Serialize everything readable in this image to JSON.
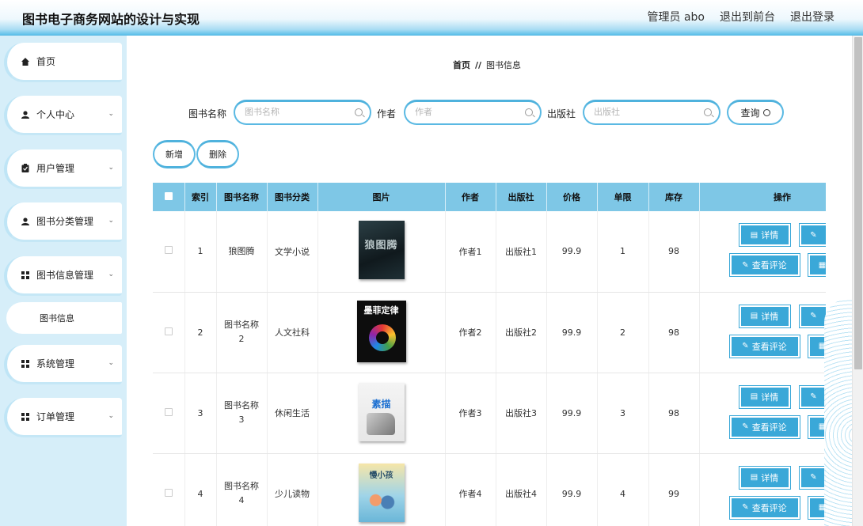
{
  "header": {
    "title": "图书电子商务网站的设计与实现",
    "user": "管理员 abo",
    "to_front": "退出到前台",
    "logout": "退出登录"
  },
  "sidebar": {
    "items": [
      {
        "label": "首页",
        "icon": "home-icon"
      },
      {
        "label": "个人中心",
        "icon": "person-icon"
      },
      {
        "label": "用户管理",
        "icon": "clipboard-icon"
      },
      {
        "label": "图书分类管理",
        "icon": "person-icon"
      },
      {
        "label": "图书信息管理",
        "icon": "grid-icon"
      },
      {
        "label": "系统管理",
        "icon": "grid-icon"
      },
      {
        "label": "订单管理",
        "icon": "grid-icon"
      }
    ],
    "subitem": "图书信息"
  },
  "breadcrumb": {
    "home": "首页",
    "sep": "//",
    "current": "图书信息"
  },
  "search": {
    "name_label": "图书名称",
    "name_placeholder": "图书名称",
    "author_label": "作者",
    "author_placeholder": "作者",
    "publisher_label": "出版社",
    "publisher_placeholder": "出版社",
    "query_label": "查询"
  },
  "actions": {
    "add": "新增",
    "delete": "删除"
  },
  "table": {
    "headers": [
      "索引",
      "图书名称",
      "图书分类",
      "图片",
      "作者",
      "出版社",
      "价格",
      "单限",
      "库存",
      "操作"
    ],
    "rows": [
      {
        "index": "1",
        "name": "狼图腾",
        "name2": "",
        "category": "文学小说",
        "cover_title": "狼图腾",
        "author": "作者1",
        "publisher": "出版社1",
        "price": "99.9",
        "limit": "1",
        "stock": "98"
      },
      {
        "index": "2",
        "name": "图书名称",
        "name2": "2",
        "category": "人文社科",
        "cover_title": "墨菲定律",
        "author": "作者2",
        "publisher": "出版社2",
        "price": "99.9",
        "limit": "2",
        "stock": "98"
      },
      {
        "index": "3",
        "name": "图书名称",
        "name2": "3",
        "category": "休闲生活",
        "cover_title": "素描",
        "author": "作者3",
        "publisher": "出版社3",
        "price": "99.9",
        "limit": "3",
        "stock": "98"
      },
      {
        "index": "4",
        "name": "图书名称",
        "name2": "4",
        "category": "少儿读物",
        "cover_title": "慢小孩",
        "author": "作者4",
        "publisher": "出版社4",
        "price": "99.9",
        "limit": "4",
        "stock": "99"
      }
    ],
    "op_detail": "详情",
    "op_reviews": "查看评论"
  }
}
